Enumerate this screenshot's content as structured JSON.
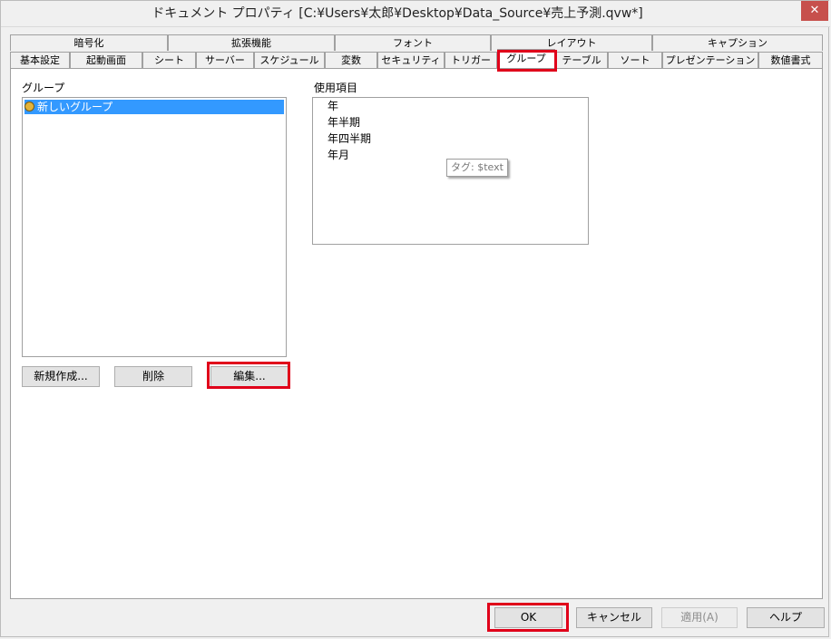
{
  "window": {
    "title": "ドキュメント プロパティ [C:¥Users¥太郎¥Desktop¥Data_Source¥売上予測.qvw*]",
    "close_glyph": "✕"
  },
  "tabs_back": [
    {
      "label": "暗号化"
    },
    {
      "label": "拡張機能"
    },
    {
      "label": "フォント"
    },
    {
      "label": "レイアウト"
    },
    {
      "label": "キャプション"
    }
  ],
  "tabs_front": [
    {
      "label": "基本設定"
    },
    {
      "label": "起動画面"
    },
    {
      "label": "シート"
    },
    {
      "label": "サーバー"
    },
    {
      "label": "スケジュール"
    },
    {
      "label": "変数"
    },
    {
      "label": "セキュリティ"
    },
    {
      "label": "トリガー"
    },
    {
      "label": "グループ",
      "selected": true
    },
    {
      "label": "テーブル"
    },
    {
      "label": "ソート"
    },
    {
      "label": "プレゼンテーション"
    },
    {
      "label": "数値書式"
    }
  ],
  "groups": {
    "label": "グループ",
    "items": [
      {
        "label": "新しいグループ",
        "selected": true,
        "icon": "cycle-group-icon"
      }
    ],
    "buttons": {
      "new": "新規作成...",
      "delete": "削除",
      "edit": "編集..."
    }
  },
  "used_fields": {
    "label": "使用項目",
    "items": [
      "年",
      "年半期",
      "年四半期",
      "年月"
    ],
    "tooltip": "タグ: $text"
  },
  "footer": {
    "ok": "OK",
    "cancel": "キャンセル",
    "apply": "適用(A)",
    "help": "ヘルプ"
  },
  "colors": {
    "highlight": "#e0001a",
    "selection": "#3399ff"
  }
}
